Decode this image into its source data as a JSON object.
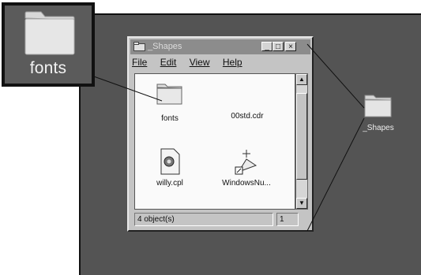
{
  "callout": {
    "label": "fonts"
  },
  "window": {
    "title": "_Shapes",
    "buttons": {
      "minimize": "_",
      "maximize": "□",
      "close": "×"
    },
    "menu": [
      "File",
      "Edit",
      "View",
      "Help"
    ],
    "items": [
      {
        "label": "fonts",
        "icon": "folder-icon"
      },
      {
        "label": "00std.cdr",
        "icon": "blank-icon"
      },
      {
        "label": "willy.cpl",
        "icon": "control-panel-file-icon"
      },
      {
        "label": "WindowsNu...",
        "icon": "shortcut-drawing-icon"
      }
    ],
    "status": {
      "objects": "4 object(s)",
      "right": "1"
    },
    "scroll": {
      "up": "▲",
      "down": "▼"
    }
  },
  "desktop": {
    "folder_label": "_Shapes"
  },
  "colors": {
    "desktop": "#545454",
    "window": "#c4c4c4",
    "titlebar_inactive": "#8c8c8c"
  }
}
